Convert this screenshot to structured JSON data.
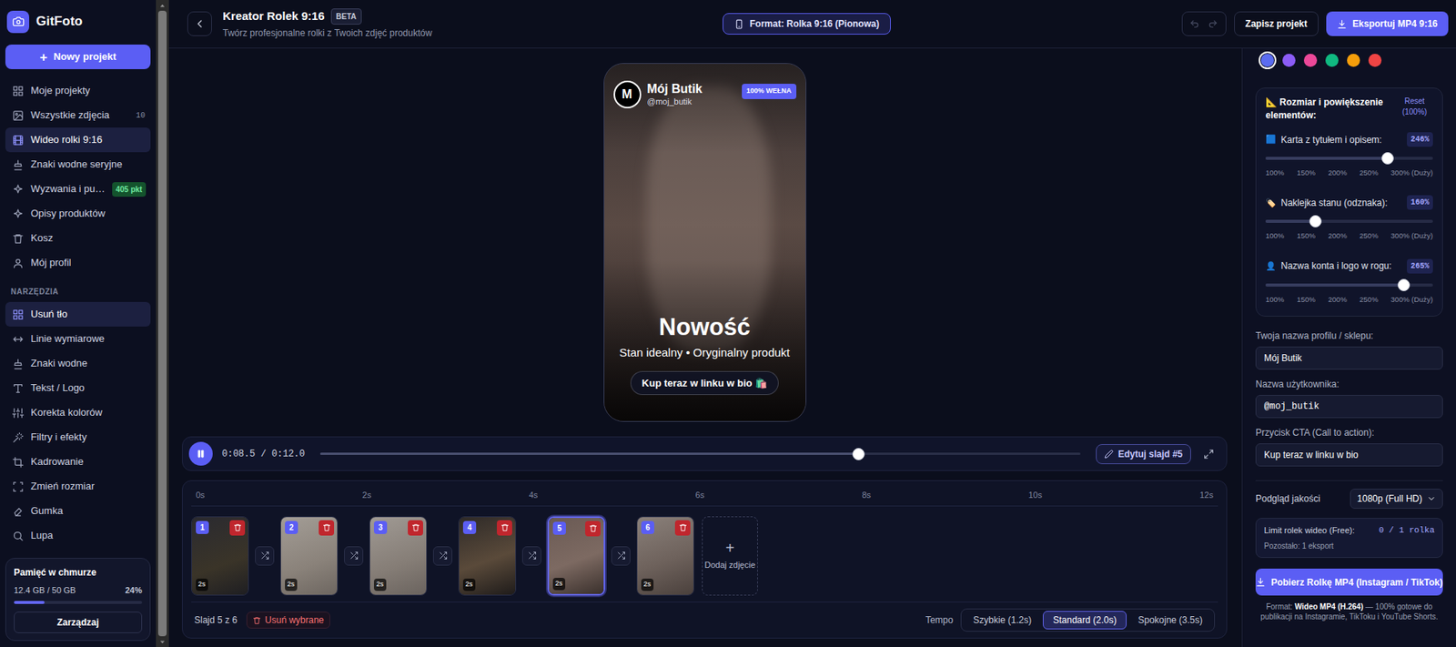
{
  "sidebar": {
    "brand": "GitFoto",
    "new_button": {
      "icon": "+",
      "label": "Nowy projekt"
    },
    "items": [
      {
        "label": "Moje projekty",
        "kind": "link",
        "selected": false
      },
      {
        "label": "Wszystkie zdjęcia",
        "kind": "count",
        "badge": "10",
        "selected": false
      },
      {
        "label": "Wideo rolki 9:16",
        "kind": "link",
        "selected": true
      },
      {
        "label": "Znaki wodne seryjne",
        "kind": "link",
        "selected": false
      },
      {
        "label": "Wyzwania i pu…",
        "kind": "points",
        "badge": "405 pkt",
        "selected": false
      },
      {
        "label": "Opisy produktów",
        "kind": "link",
        "selected": false
      },
      {
        "label": "Kosz",
        "kind": "link",
        "selected": false
      },
      {
        "label": "Mój profil",
        "kind": "link",
        "selected": false
      }
    ],
    "tools_heading": "NARZĘDZIA",
    "tools": [
      {
        "label": "Usuń tło",
        "selected": true
      },
      {
        "label": "Linie wymiarowe",
        "selected": false
      },
      {
        "label": "Znaki wodne",
        "selected": false
      },
      {
        "label": "Tekst / Logo",
        "selected": false
      },
      {
        "label": "Korekta kolorów",
        "selected": false
      },
      {
        "label": "Filtry i efekty",
        "selected": false
      },
      {
        "label": "Kadrowanie",
        "selected": false
      },
      {
        "label": "Zmień rozmiar",
        "selected": false
      },
      {
        "label": "Gumka",
        "selected": false
      },
      {
        "label": "Lupa",
        "selected": false
      }
    ],
    "storage": {
      "title": "Pamięć w chmurze",
      "usage": "12.4 GB / 50 GB",
      "percent": "24%",
      "level": 0.24,
      "button": "Zarządzaj"
    }
  },
  "topbar": {
    "title": "Kreator Rolek 9:16",
    "badge": "BETA",
    "subtitle": "Twórz profesjonalne rolki z Twoich zdjęć produktów",
    "format": "Format: Rolka 9:16 (Pionowa)",
    "undo_disabled": true,
    "redo_disabled": true,
    "save": "Zapisz projekt",
    "export": "Eksportuj MP4 9:16"
  },
  "preview": {
    "avatar": "M",
    "shop": "Mój Butik",
    "handle": "@moj_butik",
    "badge": "100% WEŁNA",
    "title": "Nowość",
    "subtitle": "Stan idealny • Oryginalny produkt",
    "cta": "Kup teraz w linku w bio 🛍️"
  },
  "player": {
    "playing": true,
    "time": "0:08.5 / 0:12.0",
    "level": 0.708,
    "edit": "Edytuj slajd #5"
  },
  "timeline": {
    "ticks": [
      "0s",
      "2s",
      "4s",
      "6s",
      "8s",
      "10s",
      "12s"
    ],
    "clips": [
      {
        "number": "1",
        "duration": "2s",
        "selected": false
      },
      {
        "number": "2",
        "duration": "2s",
        "selected": false
      },
      {
        "number": "3",
        "duration": "2s",
        "selected": false
      },
      {
        "number": "4",
        "duration": "2s",
        "selected": false
      },
      {
        "number": "5",
        "duration": "2s",
        "selected": true
      },
      {
        "number": "6",
        "duration": "2s",
        "selected": false
      }
    ],
    "add_icon": "+",
    "add": "Dodaj zdjęcie",
    "status": "Slajd 5 z 6",
    "delete": "Usuń wybrane",
    "tempo_label": "Tempo",
    "tempo": [
      {
        "label": "Szybkie (1.2s)",
        "selected": false
      },
      {
        "label": "Standard (2.0s)",
        "selected": true
      },
      {
        "label": "Spokojne (3.5s)",
        "selected": false
      }
    ]
  },
  "panel": {
    "colors": [
      {
        "color": "#5b6cf0",
        "selected": true
      },
      {
        "color": "#8b5cf6",
        "selected": false
      },
      {
        "color": "#ec4899",
        "selected": false
      },
      {
        "color": "#10b981",
        "selected": false
      },
      {
        "color": "#f59e0b",
        "selected": false
      },
      {
        "color": "#ef4444",
        "selected": false
      }
    ],
    "size": {
      "title": "📐 Rozmiar i powiększenie elementów:",
      "reset": "Reset (100%)",
      "ticks": [
        "100%",
        "150%",
        "200%",
        "250%",
        "300% (Duży)"
      ],
      "sliders": [
        {
          "icon": "🟦",
          "label": "Karta z tytułem i opisem:",
          "reading": "246%",
          "level": 0.73
        },
        {
          "icon": "🏷️",
          "label": "Naklejka stanu (odznaka):",
          "reading": "160%",
          "level": 0.3
        },
        {
          "icon": "👤",
          "label": "Nazwa konta i logo w rogu:",
          "reading": "265%",
          "level": 0.825
        }
      ]
    },
    "fields": [
      {
        "label": "Twoja nazwa profilu / sklepu:",
        "value": "Mój Butik",
        "kind": "text"
      },
      {
        "label": "Nazwa użytkownika:",
        "value": "@moj_butik",
        "kind": "mono"
      },
      {
        "label": "Przycisk CTA (Call to action):",
        "value": "Kup teraz w linku w bio",
        "kind": "text"
      }
    ],
    "quality": {
      "label": "Podgląd jakości",
      "value": "1080p (Full HD)"
    },
    "limit": {
      "label": "Limit rolek wideo (Free):",
      "count": "0 / 1 rolka",
      "remaining": "Pozostało: 1 eksport"
    },
    "download": "Pobierz Rolkę MP4 (Instagram / TikTok)",
    "note": {
      "prefix": "Format: ",
      "bold": "Wideo MP4 (H.264)",
      "suffix": " — 100% gotowe do publikacji na Instagramie, TikToku i YouTube Shorts."
    }
  }
}
